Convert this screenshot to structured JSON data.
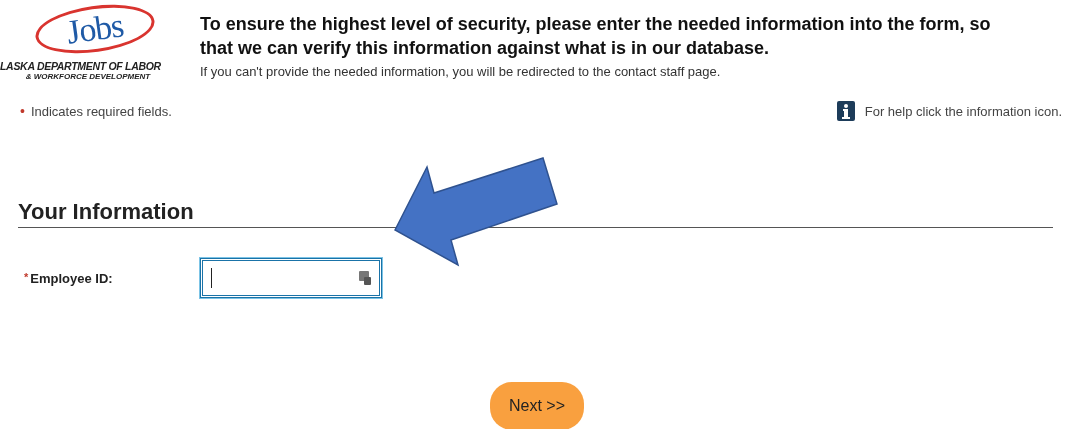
{
  "logo": {
    "mark": "Jobs",
    "agency": "LASKA DEPARTMENT OF LABOR",
    "division": "& WORKFORCE DEVELOPMENT"
  },
  "intro": {
    "heading": "To ensure the highest level of security, please enter the needed information into the form, so that we can verify this information against what is in our database.",
    "note": "If you can't provide the needed information, you will be redirected to the contact staff page."
  },
  "required_note": {
    "bullet": "•",
    "text": "Indicates required fields."
  },
  "help_note": "For help click the information icon.",
  "section": {
    "title": "Your Information"
  },
  "fields": [
    {
      "label": "Employee ID:",
      "required": true,
      "required_mark": "*",
      "focused": true
    }
  ],
  "buttons": [
    {
      "label": "Next >>"
    }
  ]
}
